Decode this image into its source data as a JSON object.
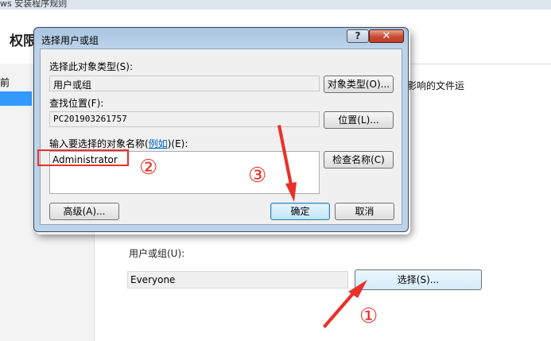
{
  "background": {
    "window_title": "ws 安装程序规则",
    "heading": "权限",
    "left_text": "前",
    "right_text": "影响的文件运",
    "user_group_label": "用户或组(U):",
    "user_group_value": "Everyone",
    "select_button": "选择(S)..."
  },
  "dialog": {
    "title": "选择用户或组",
    "help_glyph": "?",
    "close_glyph": "✕",
    "object_type_label": "选择此对象类型(S):",
    "object_type_value": "用户或组",
    "object_type_button": "对象类型(O)...",
    "location_label": "查找位置(F):",
    "location_value": "PC201903261757",
    "location_button": "位置(L)...",
    "names_label_pre": "输入要选择的对象名称(",
    "names_label_link": "例如",
    "names_label_post": ")(E):",
    "names_value": "Administrator",
    "check_names_button": "检查名称(C)",
    "advanced_button": "高级(A)...",
    "ok_button": "确定",
    "cancel_button": "取消"
  },
  "annotations": {
    "step1": "①",
    "step2": "②",
    "step3": "③",
    "color": "#e8312a"
  }
}
